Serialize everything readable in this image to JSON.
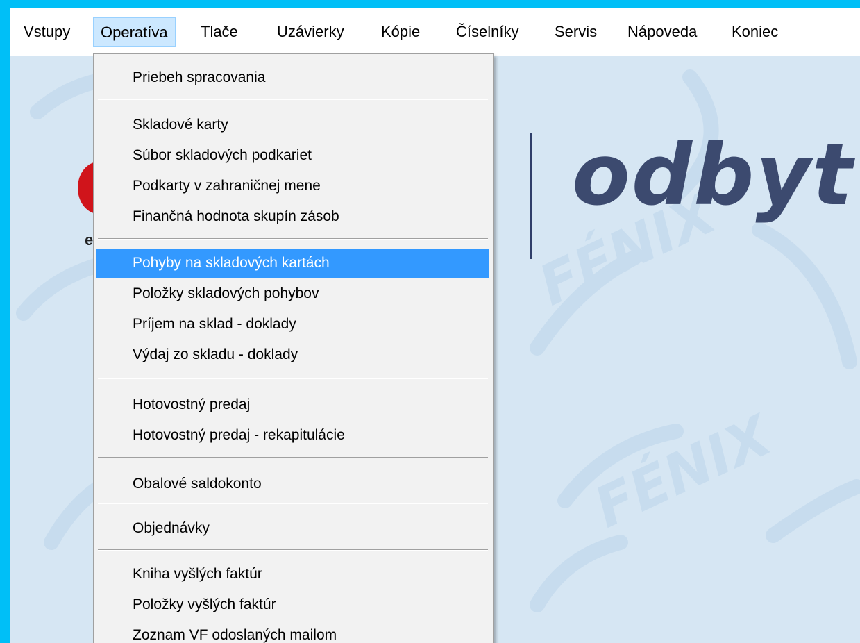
{
  "menubar": {
    "items": [
      {
        "label": "Vstupy"
      },
      {
        "label": "Operatíva"
      },
      {
        "label": "Tlače"
      },
      {
        "label": "Uzávierky"
      },
      {
        "label": "Kópie"
      },
      {
        "label": "Číselníky"
      },
      {
        "label": "Servis"
      },
      {
        "label": "Nápoveda"
      },
      {
        "label": "Koniec"
      }
    ],
    "active_index": 1
  },
  "background": {
    "brand_word": "odbyt",
    "logo_fragment": "e",
    "watermark": "FÉNIX"
  },
  "dropdown": {
    "items": [
      {
        "label": "Priebeh spracovania"
      },
      {
        "label": "Skladové karty"
      },
      {
        "label": "Súbor skladových podkariet"
      },
      {
        "label": "Podkarty v zahraničnej mene"
      },
      {
        "label": "Finančná hodnota skupín zásob"
      },
      {
        "label": "Pohyby na skladových kartách"
      },
      {
        "label": "Položky skladových pohybov"
      },
      {
        "label": "Príjem na sklad - doklady"
      },
      {
        "label": "Výdaj zo skladu - doklady"
      },
      {
        "label": "Hotovostný predaj"
      },
      {
        "label": "Hotovostný predaj - rekapitulácie"
      },
      {
        "label": "Obalové saldokonto"
      },
      {
        "label": "Objednávky"
      },
      {
        "label": "Kniha vyšlých faktúr"
      },
      {
        "label": "Položky vyšlých faktúr"
      },
      {
        "label": "Zoznam VF odoslaných mailom"
      }
    ],
    "selected_label": "Pohyby na skladových kartách"
  },
  "colors": {
    "screen_border": "#00bff7",
    "desktop": "#d6e6f3",
    "highlight": "#3399ff",
    "menu_active": "#cce8ff",
    "brand": "#3c4a6f",
    "logo_red": "#d0141b"
  }
}
